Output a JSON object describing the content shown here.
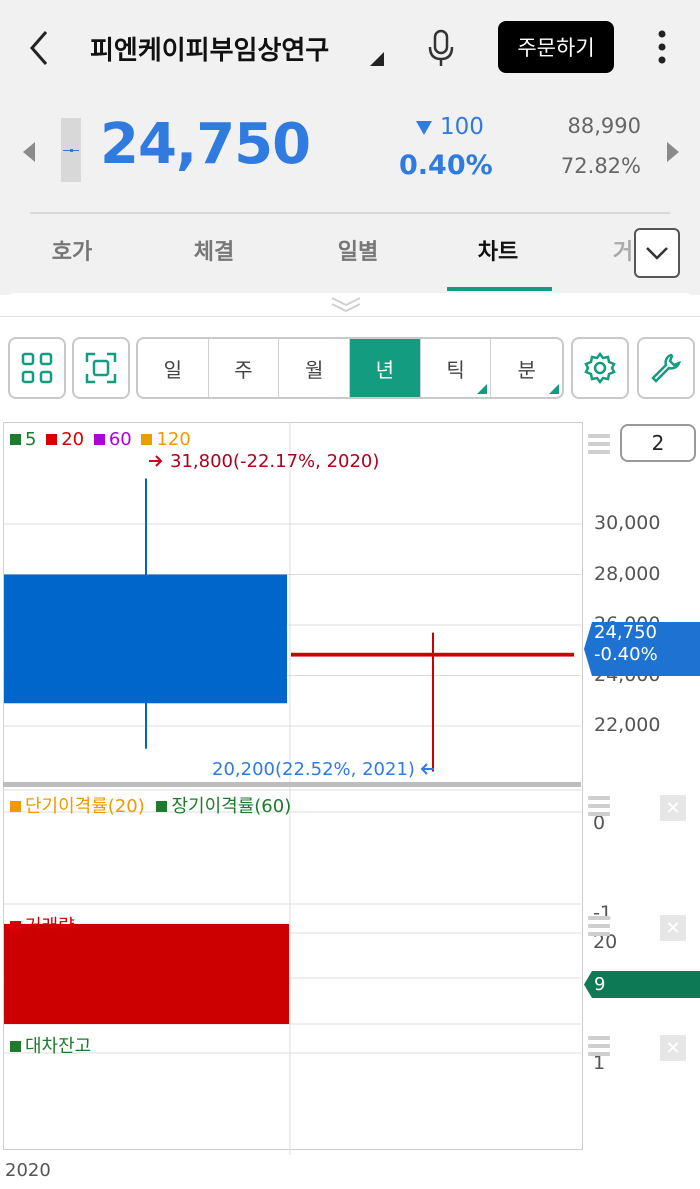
{
  "header": {
    "title": "피엔케이피부임상연구",
    "order_button": "주문하기"
  },
  "quote": {
    "price": "24,750",
    "change": "100",
    "change_pct": "0.40%",
    "volume": "88,990",
    "ratio": "72.82%"
  },
  "tabs": [
    "호가",
    "체결",
    "일별",
    "차트",
    "거"
  ],
  "active_tab": "차트",
  "periods": [
    "일",
    "주",
    "월",
    "년",
    "틱",
    "분"
  ],
  "active_period": "년",
  "count_box": "2",
  "price_chart": {
    "legend": [
      {
        "label": "5",
        "color": "#1e7a2c"
      },
      {
        "label": "20",
        "color": "#d50000"
      },
      {
        "label": "60",
        "color": "#b000d8"
      },
      {
        "label": "120",
        "color": "#ef9a00"
      }
    ],
    "high_annotation": "31,800(-22.17%, 2020)",
    "low_annotation": "20,200(22.52%, 2021)",
    "y_ticks": [
      "30,000",
      "28,000",
      "26,000",
      "24,000",
      "22,000"
    ],
    "current_tag_price": "24,750",
    "current_tag_pct": "-0.40%"
  },
  "disparity_chart": {
    "legend": [
      {
        "label": "단기이격률(20)",
        "color": "#ef9a00"
      },
      {
        "label": "장기이격률(60)",
        "color": "#1e7a2c"
      }
    ],
    "y_ticks": [
      "0",
      "-1"
    ]
  },
  "volume_chart": {
    "legend": "거래량",
    "y_tick": "20",
    "current_tag": "9"
  },
  "loan_chart": {
    "legend": "대차잔고",
    "y_tick": "1"
  },
  "x_axis_label": "2020",
  "chart_data": [
    {
      "type": "candlestick",
      "title": "",
      "x": [
        "2020",
        "2021"
      ],
      "series": [
        {
          "open": 22900,
          "high": 31800,
          "low": 21100,
          "close": 28000,
          "color": "#0066cc"
        },
        {
          "open": 24900,
          "high": 25700,
          "low": 20200,
          "close": 24750,
          "color": "#cc0000"
        }
      ],
      "ylim": [
        20000,
        32000
      ],
      "y_ticks": [
        22000,
        24000,
        26000,
        28000,
        30000
      ]
    },
    {
      "type": "bar",
      "title": "거래량",
      "categories": [
        "2020",
        "2021"
      ],
      "values": [
        22,
        9
      ]
    }
  ]
}
